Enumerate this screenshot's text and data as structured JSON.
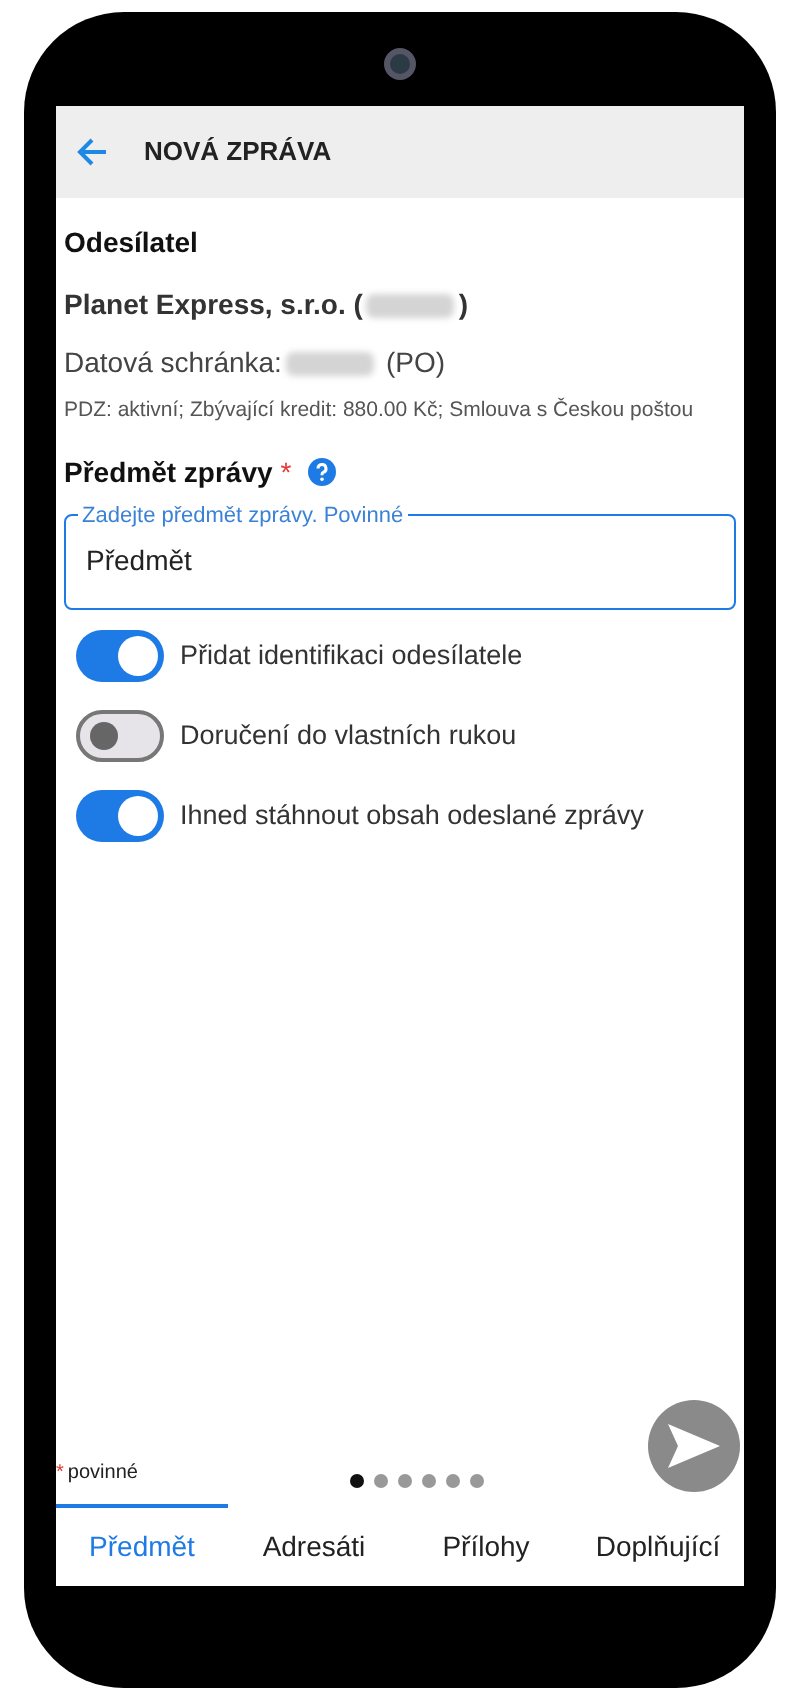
{
  "header": {
    "title": "NOVÁ ZPRÁVA"
  },
  "sender": {
    "heading": "Odesílatel",
    "name_before": "Planet Express, s.r.o. (",
    "name_after": ")",
    "box_label": "Datová schránka:",
    "box_type": "(PO)",
    "details": "PDZ: aktivní; Zbývající kredit: 880.00 Kč; Smlouva s Českou poštou"
  },
  "subject": {
    "label": "Předmět zprávy",
    "required_mark": "*",
    "field_label": "Zadejte předmět zprávy. Povinné",
    "value": "Předmět"
  },
  "switches": [
    {
      "label": "Přidat identifikaci odesílatele",
      "on": true
    },
    {
      "label": "Doručení do vlastních rukou",
      "on": false
    },
    {
      "label": "Ihned stáhnout obsah odeslané zprávy",
      "on": true
    }
  ],
  "footer": {
    "required_mark": "*",
    "required_note": "povinné",
    "pages": [
      {
        "selected": true
      },
      {
        "selected": false
      },
      {
        "selected": false
      },
      {
        "selected": false
      },
      {
        "selected": false
      },
      {
        "selected": false
      }
    ]
  },
  "tabs": [
    {
      "label": "Předmět",
      "selected": true
    },
    {
      "label": "Adresáti",
      "selected": false
    },
    {
      "label": "Přílohy",
      "selected": false
    },
    {
      "label": "Doplňující",
      "selected": false
    }
  ]
}
